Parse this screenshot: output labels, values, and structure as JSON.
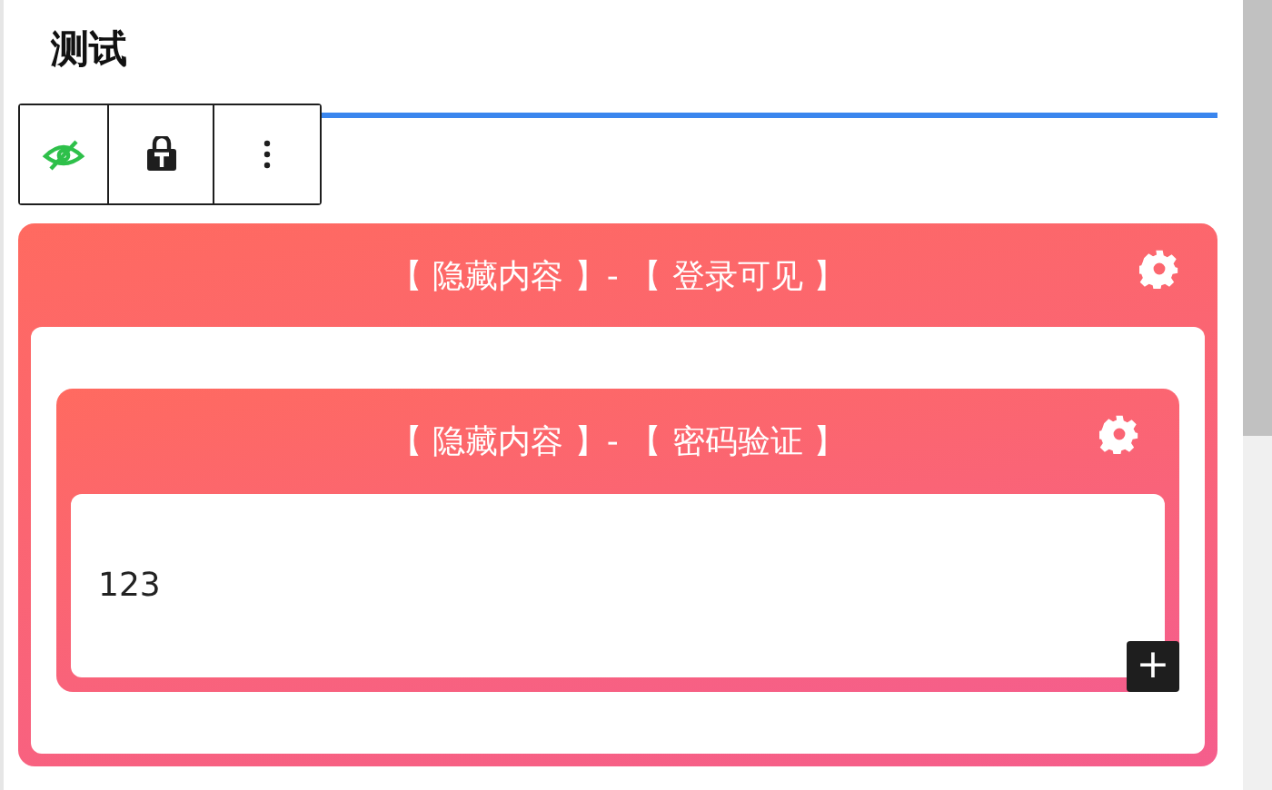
{
  "page": {
    "title": "测试"
  },
  "toolbar": {
    "buttons": [
      {
        "kind": "visibility"
      },
      {
        "kind": "lock"
      },
      {
        "kind": "more"
      }
    ]
  },
  "blocks": [
    {
      "title": "【 隐藏内容 】- 【 登录可见 】",
      "children": [
        {
          "title": "【 隐藏内容 】- 【 密码验证 】",
          "content": "123",
          "add_button": "+"
        }
      ]
    }
  ]
}
